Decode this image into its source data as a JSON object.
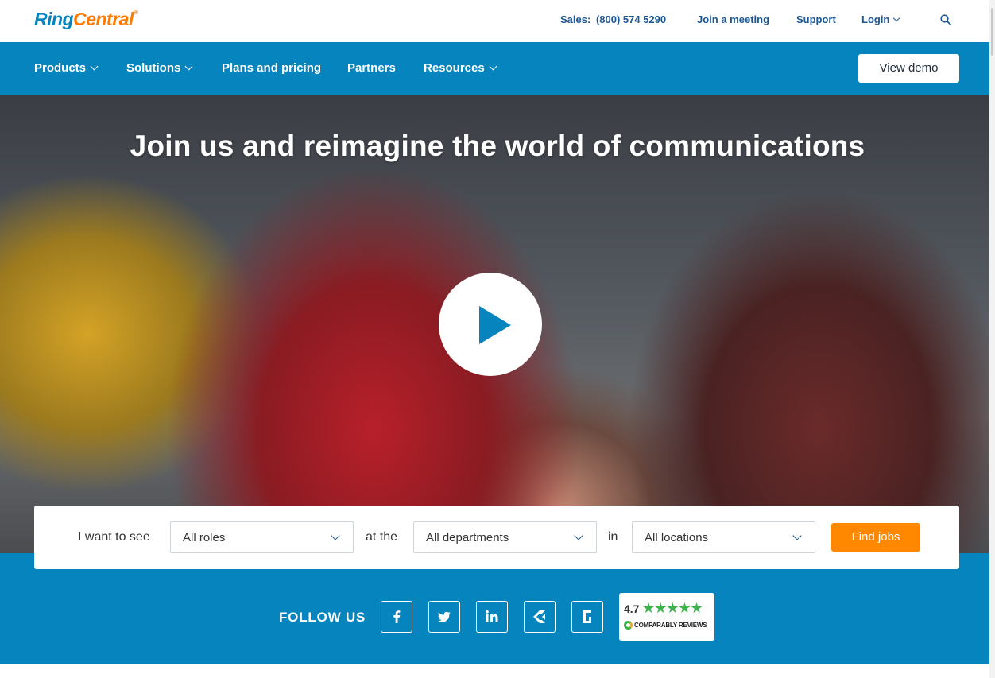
{
  "header": {
    "logo_ring": "Ring",
    "logo_central": "Central",
    "logo_reg": "®",
    "sales_label": "Sales:",
    "sales_phone": "(800) 574 5290",
    "join_meeting": "Join a meeting",
    "support": "Support",
    "login": "Login"
  },
  "nav": {
    "products": "Products",
    "solutions": "Solutions",
    "plans": "Plans and pricing",
    "partners": "Partners",
    "resources": "Resources",
    "demo_button": "View demo"
  },
  "hero": {
    "title": "Join us and reimagine the world of communications"
  },
  "job_search": {
    "label_see": "I want to see",
    "roles_value": "All roles",
    "label_at": "at the",
    "departments_value": "All departments",
    "label_in": "in",
    "locations_value": "All locations",
    "find_button": "Find jobs"
  },
  "follow": {
    "label": "FOLLOW US",
    "icons": [
      "facebook-icon",
      "twitter-icon",
      "linkedin-icon",
      "glassdoor-c-icon",
      "glassdoor-g-icon"
    ],
    "comparably_rating": "4.7",
    "comparably_stars": "★★★★★",
    "comparably_brand": "COMPARABLY REVIEWS"
  },
  "colors": {
    "brand_blue": "#0684bd",
    "brand_orange": "#ff7a00",
    "cta_orange": "#ff8800",
    "link_navy": "#1c5795"
  }
}
